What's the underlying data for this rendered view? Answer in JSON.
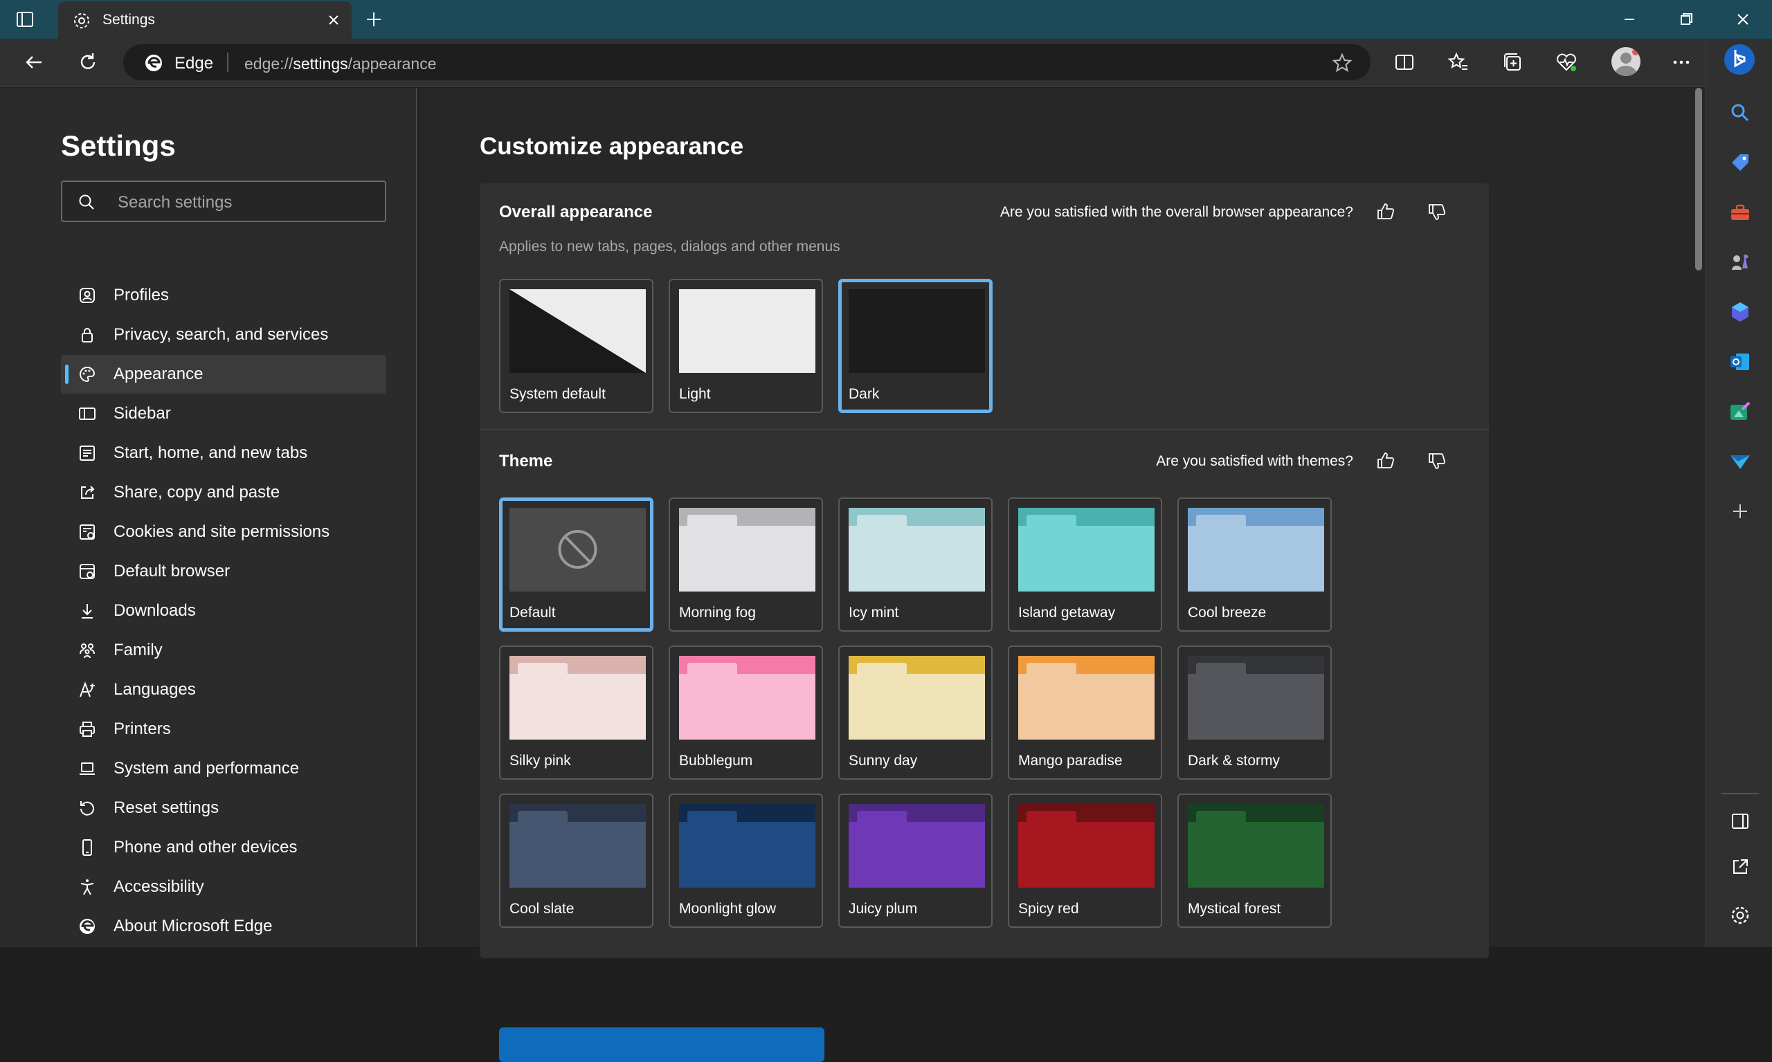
{
  "browser": {
    "tab_title": "Settings",
    "omnibox_brand": "Edge",
    "url_scheme": "edge://",
    "url_bold": "settings",
    "url_rest": "/appearance"
  },
  "sidebar": {
    "title": "Settings",
    "search_placeholder": "Search settings",
    "items": [
      {
        "label": "Profiles",
        "icon": "profile-icon"
      },
      {
        "label": "Privacy, search, and services",
        "icon": "lock-icon"
      },
      {
        "label": "Appearance",
        "icon": "palette-icon",
        "active": true
      },
      {
        "label": "Sidebar",
        "icon": "sidebar-icon"
      },
      {
        "label": "Start, home, and new tabs",
        "icon": "home-tabs-icon"
      },
      {
        "label": "Share, copy and paste",
        "icon": "share-icon"
      },
      {
        "label": "Cookies and site permissions",
        "icon": "cookies-icon"
      },
      {
        "label": "Default browser",
        "icon": "browser-icon"
      },
      {
        "label": "Downloads",
        "icon": "download-icon"
      },
      {
        "label": "Family",
        "icon": "family-icon"
      },
      {
        "label": "Languages",
        "icon": "languages-icon"
      },
      {
        "label": "Printers",
        "icon": "printer-icon"
      },
      {
        "label": "System and performance",
        "icon": "laptop-icon"
      },
      {
        "label": "Reset settings",
        "icon": "reset-icon"
      },
      {
        "label": "Phone and other devices",
        "icon": "phone-icon"
      },
      {
        "label": "Accessibility",
        "icon": "accessibility-icon"
      },
      {
        "label": "About Microsoft Edge",
        "icon": "edge-logo-icon"
      }
    ]
  },
  "main": {
    "page_title": "Customize appearance",
    "overall": {
      "title": "Overall appearance",
      "subtitle": "Applies to new tabs, pages, dialogs and other menus",
      "feedback": "Are you satisfied with the overall browser appearance?",
      "options": [
        {
          "label": "System default"
        },
        {
          "label": "Light"
        },
        {
          "label": "Dark",
          "selected": true
        }
      ]
    },
    "theme": {
      "title": "Theme",
      "feedback": "Are you satisfied with themes?",
      "themes": [
        {
          "label": "Default",
          "selected": true,
          "top": "#4a4a4a",
          "body": "#4a4a4a"
        },
        {
          "label": "Morning fog",
          "top": "#b3b3b6",
          "body": "#e1e1e4"
        },
        {
          "label": "Icy mint",
          "top": "#8fc6c9",
          "body": "#c8e2e6"
        },
        {
          "label": "Island getaway",
          "top": "#4ab1ae",
          "body": "#74d3d3"
        },
        {
          "label": "Cool breeze",
          "top": "#6e9fce",
          "body": "#a6c6e1"
        },
        {
          "label": "Silky pink",
          "top": "#d9b2ad",
          "body": "#f2e1df"
        },
        {
          "label": "Bubblegum",
          "top": "#f57aa8",
          "body": "#fab9d2"
        },
        {
          "label": "Sunny day",
          "top": "#e0b93c",
          "body": "#f0e2b7"
        },
        {
          "label": "Mango paradise",
          "top": "#ef9a3c",
          "body": "#f2c89e"
        },
        {
          "label": "Dark & stormy",
          "top": "#343538",
          "body": "#55565b"
        },
        {
          "label": "Cool slate",
          "top": "#2a3547",
          "body": "#455670"
        },
        {
          "label": "Moonlight glow",
          "top": "#11294a",
          "body": "#1f4a82"
        },
        {
          "label": "Juicy plum",
          "top": "#4e2a86",
          "body": "#6e38b6"
        },
        {
          "label": "Spicy red",
          "top": "#6c1214",
          "body": "#a6171f"
        },
        {
          "label": "Mystical forest",
          "top": "#173f22",
          "body": "#22632f"
        }
      ]
    }
  },
  "colors": {
    "accent": "#4cc2ff",
    "selection_border": "#6cb1e8",
    "titlebar": "#1d4a58"
  }
}
